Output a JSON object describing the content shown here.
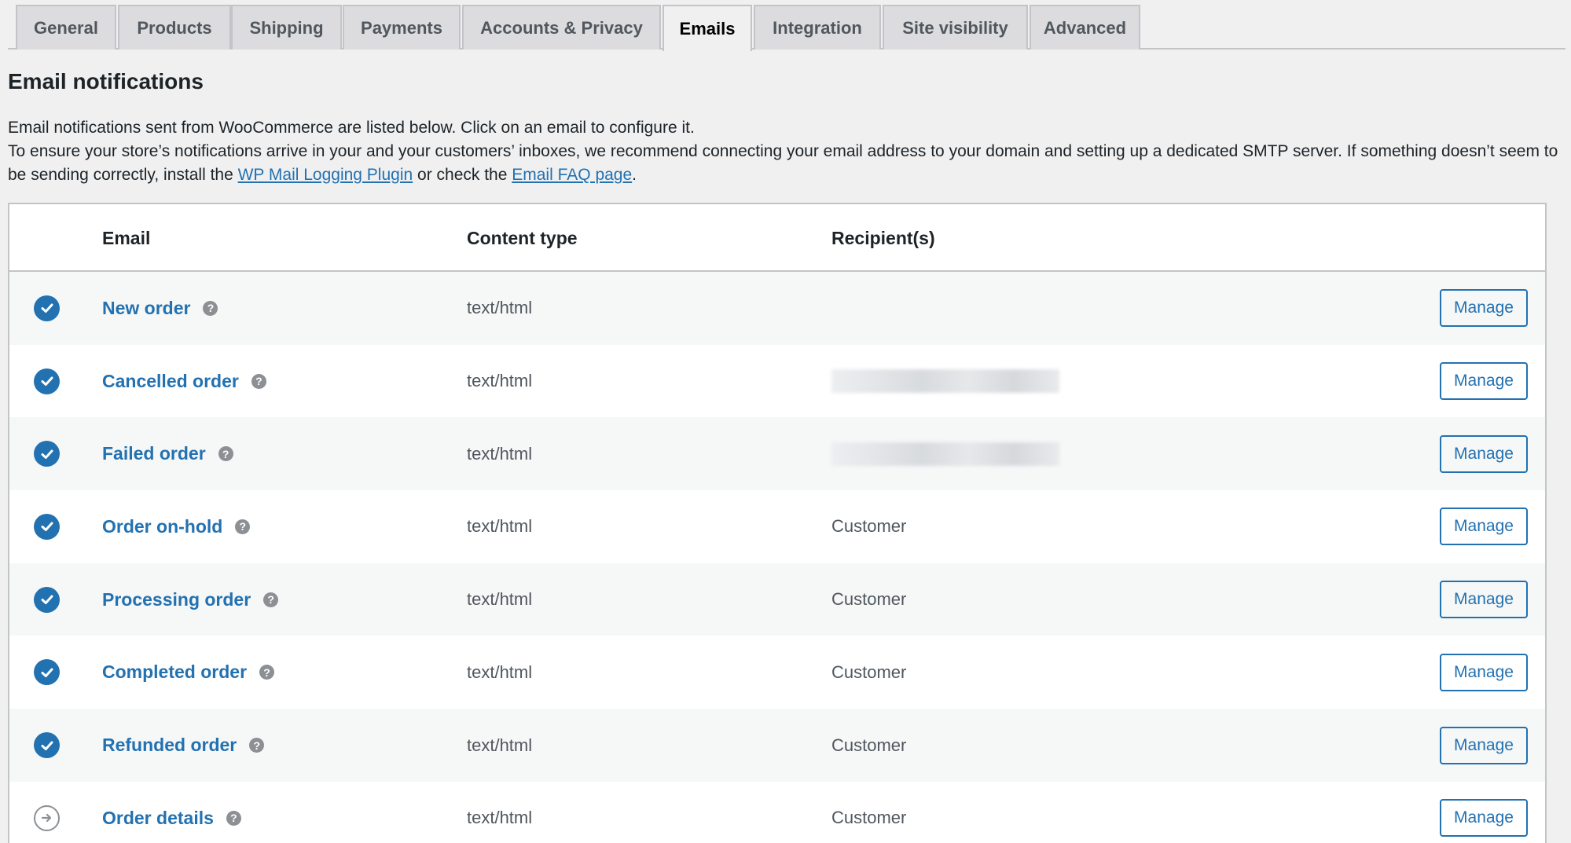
{
  "tabs": [
    {
      "label": "General",
      "active": false
    },
    {
      "label": "Products",
      "active": false
    },
    {
      "label": "Shipping",
      "active": false
    },
    {
      "label": "Payments",
      "active": false
    },
    {
      "label": "Accounts & Privacy",
      "active": false
    },
    {
      "label": "Emails",
      "active": true
    },
    {
      "label": "Integration",
      "active": false
    },
    {
      "label": "Site visibility",
      "active": false
    },
    {
      "label": "Advanced",
      "active": false
    }
  ],
  "heading": "Email notifications",
  "description": {
    "line1": "Email notifications sent from WooCommerce are listed below. Click on an email to configure it.",
    "line2_before": "To ensure your store’s notifications arrive in your and your customers’ inboxes, we recommend connecting your email address to your domain and setting up a dedicated SMTP server. If something doesn’t seem to be sending correctly, install the ",
    "link1": "WP Mail Logging Plugin",
    "between": " or check the ",
    "link2": "Email FAQ page",
    "after": "."
  },
  "table": {
    "headers": {
      "email": "Email",
      "content_type": "Content type",
      "recipients": "Recipient(s)"
    },
    "manage_label": "Manage",
    "help_glyph": "?",
    "rows": [
      {
        "status": "enabled",
        "name": "New order",
        "content_type": "text/html",
        "recipient": ""
      },
      {
        "status": "enabled",
        "name": "Cancelled order",
        "content_type": "text/html",
        "recipient": "",
        "recipient_redacted": true
      },
      {
        "status": "enabled",
        "name": "Failed order",
        "content_type": "text/html",
        "recipient": "",
        "recipient_redacted": true
      },
      {
        "status": "enabled",
        "name": "Order on-hold",
        "content_type": "text/html",
        "recipient": "Customer"
      },
      {
        "status": "enabled",
        "name": "Processing order",
        "content_type": "text/html",
        "recipient": "Customer"
      },
      {
        "status": "enabled",
        "name": "Completed order",
        "content_type": "text/html",
        "recipient": "Customer"
      },
      {
        "status": "enabled",
        "name": "Refunded order",
        "content_type": "text/html",
        "recipient": "Customer"
      },
      {
        "status": "manual",
        "name": "Order details",
        "content_type": "text/html",
        "recipient": "Customer"
      }
    ]
  },
  "colors": {
    "accent": "#2271b1",
    "muted": "#8c8f94"
  }
}
